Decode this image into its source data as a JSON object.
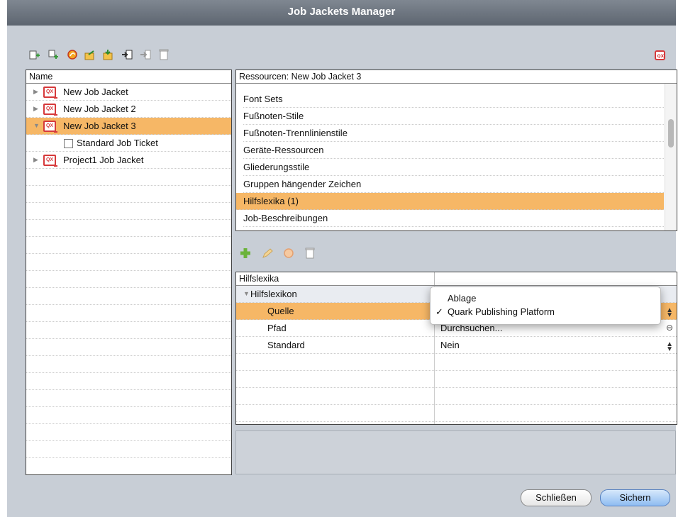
{
  "window": {
    "title": "Job Jackets Manager"
  },
  "left_toolbar": {
    "icons": [
      "new-jacket-icon",
      "new-ticket-icon",
      "duplicate-icon",
      "export-icon",
      "import-icon",
      "link-icon",
      "unlink-icon",
      "trash-icon"
    ]
  },
  "tree": {
    "header": "Name",
    "items": [
      {
        "label": "New Job Jacket"
      },
      {
        "label": "New Job Jacket 2"
      },
      {
        "label": "New Job Jacket 3"
      },
      {
        "label": "Standard Job Ticket"
      },
      {
        "label": "Project1 Job Jacket"
      }
    ],
    "qx_text": "QX"
  },
  "resources": {
    "header": "Ressourcen: New Job Jacket 3",
    "items": [
      {
        "label": "Font Sets"
      },
      {
        "label": "Fußnoten-Stile"
      },
      {
        "label": "Fußnoten-Trennlinienstile"
      },
      {
        "label": "Geräte-Ressourcen"
      },
      {
        "label": "Gliederungsstile"
      },
      {
        "label": "Gruppen hängender Zeichen"
      },
      {
        "label": "Hilfslexika (1)"
      },
      {
        "label": "Job-Beschreibungen"
      }
    ]
  },
  "props": {
    "header": "Hilfslexika",
    "group": "Hilfslexikon",
    "rows": [
      {
        "label": "Quelle",
        "value": ""
      },
      {
        "label": "Pfad",
        "value": "Durchsuchen..."
      },
      {
        "label": "Standard",
        "value": "Nein"
      }
    ]
  },
  "popup": {
    "options": [
      "Ablage",
      "Quark Publishing Platform"
    ],
    "selected_mark": "✓"
  },
  "buttons": {
    "close": "Schließen",
    "save": "Sichern"
  },
  "colors": {
    "selection": "#f6b766",
    "qx_red": "#d6393b",
    "green": "#6bb33a"
  }
}
